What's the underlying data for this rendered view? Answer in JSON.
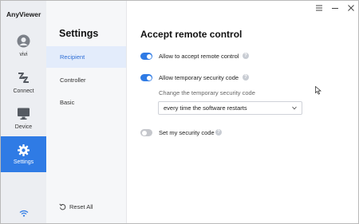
{
  "app": {
    "title": "AnyViewer"
  },
  "rail": {
    "items": [
      {
        "label": "vivi",
        "icon": "user-avatar-icon"
      },
      {
        "label": "Connect",
        "icon": "connect-icon"
      },
      {
        "label": "Device",
        "icon": "monitor-icon"
      },
      {
        "label": "Settings",
        "icon": "gear-icon",
        "active": true
      }
    ],
    "status_icon": "wifi-icon"
  },
  "nav": {
    "title": "Settings",
    "items": [
      {
        "label": "Recipient",
        "active": true
      },
      {
        "label": "Controller"
      },
      {
        "label": "Basic"
      }
    ],
    "reset_label": "Reset All"
  },
  "main": {
    "title": "Accept remote control",
    "options": [
      {
        "label": "Allow to accept remote control",
        "enabled": true
      },
      {
        "label": "Allow temporary security code",
        "enabled": true
      },
      {
        "label": "Set my security code",
        "enabled": false
      }
    ],
    "change_code_label": "Change the temporary security code",
    "change_code_select": "every time the software restarts",
    "help_glyph": "?"
  },
  "window": {
    "controls": [
      "menu-icon",
      "minimize-icon",
      "close-icon"
    ]
  },
  "colors": {
    "accent": "#2f7be5",
    "rail_bg": "#eceef2",
    "nav_bg": "#f6f7f9",
    "nav_active_bg": "#e3ecfb"
  }
}
